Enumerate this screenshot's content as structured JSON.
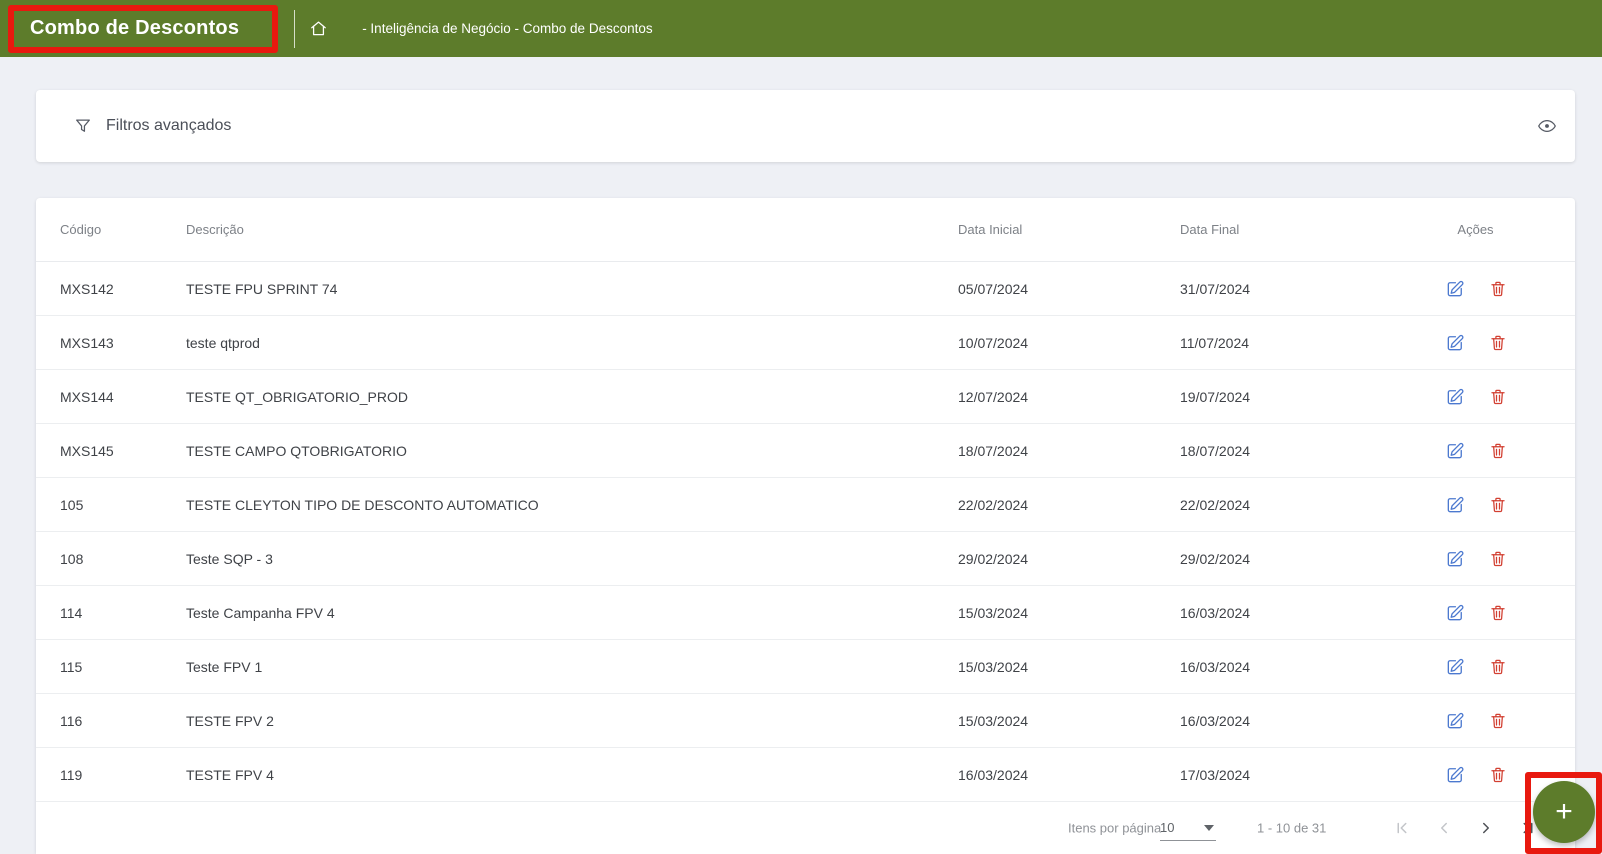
{
  "header": {
    "title": "Combo de Descontos",
    "breadcrumb": "- Inteligência de Negócio - Combo de Descontos"
  },
  "filters": {
    "label": "Filtros avançados"
  },
  "table": {
    "columns": [
      "Código",
      "Descrição",
      "Data Inicial",
      "Data Final",
      "Ações"
    ],
    "rows": [
      {
        "codigo": "MXS142",
        "descricao": "TESTE FPU SPRINT 74",
        "data_inicial": "05/07/2024",
        "data_final": "31/07/2024"
      },
      {
        "codigo": "MXS143",
        "descricao": "teste qtprod",
        "data_inicial": "10/07/2024",
        "data_final": "11/07/2024"
      },
      {
        "codigo": "MXS144",
        "descricao": "TESTE QT_OBRIGATORIO_PROD",
        "data_inicial": "12/07/2024",
        "data_final": "19/07/2024"
      },
      {
        "codigo": "MXS145",
        "descricao": "TESTE CAMPO QTOBRIGATORIO",
        "data_inicial": "18/07/2024",
        "data_final": "18/07/2024"
      },
      {
        "codigo": "105",
        "descricao": "TESTE CLEYTON TIPO DE DESCONTO AUTOMATICO",
        "data_inicial": "22/02/2024",
        "data_final": "22/02/2024"
      },
      {
        "codigo": "108",
        "descricao": "Teste SQP - 3",
        "data_inicial": "29/02/2024",
        "data_final": "29/02/2024"
      },
      {
        "codigo": "114",
        "descricao": "Teste Campanha FPV 4",
        "data_inicial": "15/03/2024",
        "data_final": "16/03/2024"
      },
      {
        "codigo": "115",
        "descricao": "Teste FPV 1",
        "data_inicial": "15/03/2024",
        "data_final": "16/03/2024"
      },
      {
        "codigo": "116",
        "descricao": "TESTE FPV 2",
        "data_inicial": "15/03/2024",
        "data_final": "16/03/2024"
      },
      {
        "codigo": "119",
        "descricao": "TESTE FPV 4",
        "data_inicial": "16/03/2024",
        "data_final": "17/03/2024"
      }
    ]
  },
  "pagination": {
    "items_per_page_label": "Itens por página",
    "items_per_page_value": "10",
    "range_label": "1 - 10 de 31"
  },
  "fab": {
    "label": "+"
  },
  "colors": {
    "header_green": "#5d7c2b",
    "fab_green": "#5d7c2b",
    "annotation_red": "#e8190f",
    "edit_blue": "#4c79cf",
    "delete_red": "#d23f31"
  },
  "icons": {
    "home": "home-icon",
    "filter": "funnel-icon",
    "visibility": "eye-icon",
    "edit": "edit-pencil-icon",
    "delete": "trash-icon",
    "first_page": "first-page-icon",
    "prev_page": "chevron-left-icon",
    "next_page": "chevron-right-icon",
    "last_page": "last-page-icon",
    "select_caret": "caret-down-icon"
  }
}
